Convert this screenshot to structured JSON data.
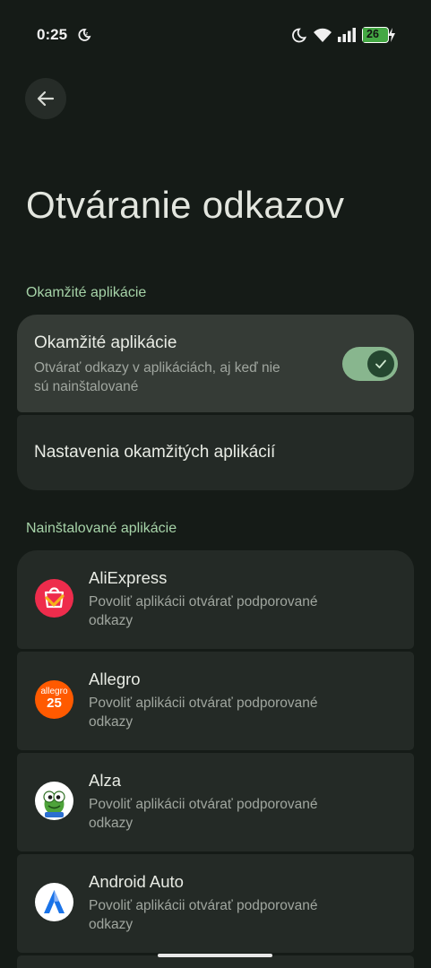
{
  "status_bar": {
    "time": "0:25",
    "battery": "26"
  },
  "header": {
    "title": "Otváranie odkazov"
  },
  "instant_apps": {
    "section_label": "Okamžité aplikácie",
    "toggle_title": "Okamžité aplikácie",
    "toggle_subtitle_line1": "Otvárať odkazy v aplikáciách, aj keď nie",
    "toggle_subtitle_line2": "sú nainštalované",
    "toggle_on": true,
    "settings_label": "Nastavenia okamžitých aplikácií"
  },
  "installed": {
    "section_label": "Nainštalované aplikácie",
    "apps": [
      {
        "name": "AliExpress",
        "subtitle_line1": "Povoliť aplikácii otvárať podporované",
        "subtitle_line2": "odkazy",
        "icon": "aliexpress-icon"
      },
      {
        "name": "Allegro",
        "subtitle_line1": "Povoliť aplikácii otvárať podporované",
        "subtitle_line2": "odkazy",
        "icon": "allegro-icon",
        "icon_text1": "allegro",
        "icon_text2": "25"
      },
      {
        "name": "Alza",
        "subtitle_line1": "Povoliť aplikácii otvárať podporované",
        "subtitle_line2": "odkazy",
        "icon": "alza-icon"
      },
      {
        "name": "Android Auto",
        "subtitle_line1": "Povoliť aplikácii otvárať podporované",
        "subtitle_line2": "odkazy",
        "icon": "android-auto-icon"
      }
    ]
  },
  "colors": {
    "background": "#151b17",
    "card": "#242a26",
    "accent_green": "#a6d3a8",
    "toggle_track": "#88b68e"
  }
}
